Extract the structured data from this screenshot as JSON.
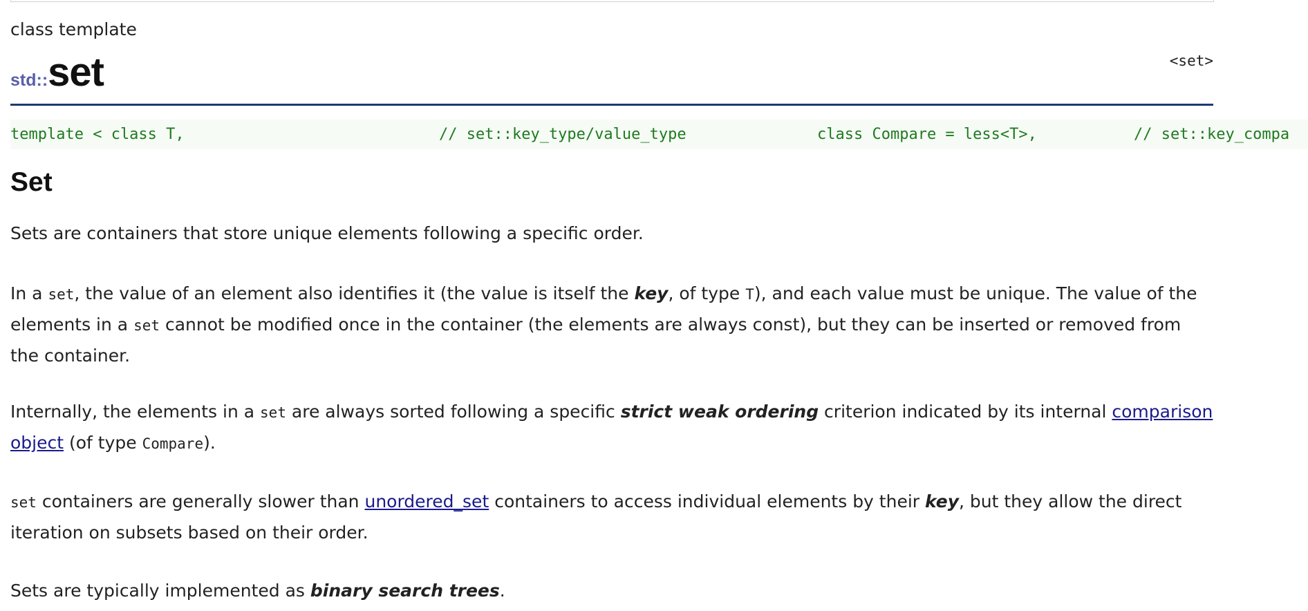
{
  "page": {
    "kind_label": "class template",
    "header_file": "<set>",
    "title_namespace": "std::",
    "title_name": "set"
  },
  "code": {
    "part1": "template < class T,",
    "part2": "// set::key_type/value_type",
    "part3": "class Compare = less<T>,",
    "part4": "// set::key_compa"
  },
  "section": {
    "title": "Set"
  },
  "paragraphs": {
    "p1": "Sets are containers that store unique elements following a specific order.",
    "p2": {
      "t1": "In a ",
      "c1": "set",
      "t2": ", the value of an element also identifies it (the value is itself the ",
      "b1": "key",
      "t3": ", of type ",
      "c2": "T",
      "t4": "), and each value must be unique. The value of the elements in a ",
      "c3": "set",
      "t5": " cannot be modified once in the container (the elements are always const), but they can be inserted or removed from the container."
    },
    "p3": {
      "t1": "Internally, the elements in a ",
      "c1": "set",
      "t2": " are always sorted following a specific ",
      "b1": "strict weak ordering",
      "t3": " criterion indicated by its internal ",
      "link1": "comparison object",
      "t4": " (of type ",
      "c2": "Compare",
      "t5": ")."
    },
    "p4": {
      "c1": "set",
      "t1": " containers are generally slower than ",
      "link1": "unordered_set",
      "t2": " containers to access individual elements by their ",
      "b1": "key",
      "t3": ", but they allow the direct iteration on subsets based on their order."
    },
    "p5": {
      "t1": "Sets are typically implemented as ",
      "b1": "binary search trees",
      "t2": "."
    }
  }
}
